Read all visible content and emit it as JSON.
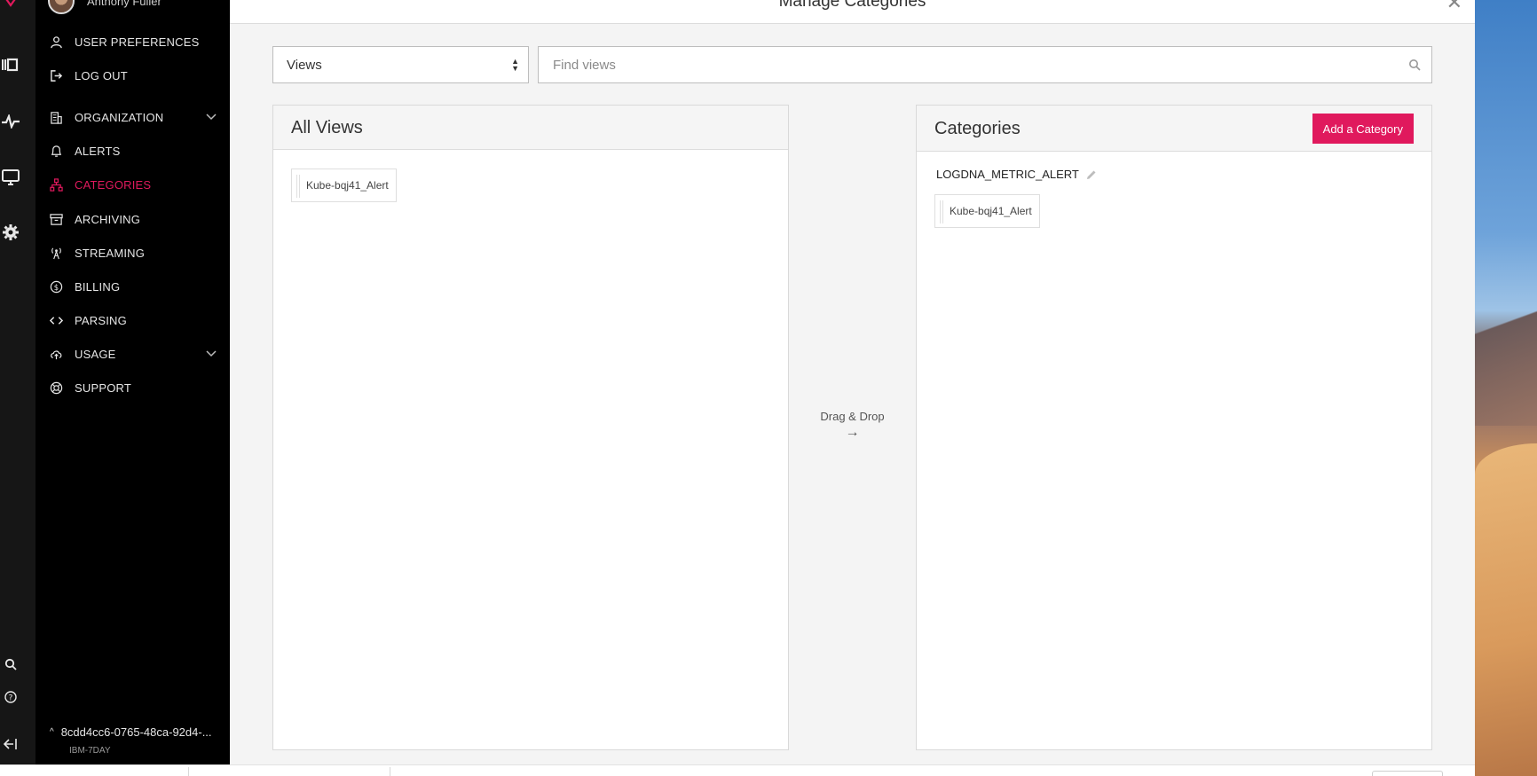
{
  "sidebar": {
    "user_name": "Anthony Fuller",
    "items": [
      {
        "label": "USER PREFERENCES",
        "icon": "user-icon"
      },
      {
        "label": "LOG OUT",
        "icon": "logout-icon"
      },
      {
        "label": "ORGANIZATION",
        "icon": "building-icon",
        "expandable": true
      },
      {
        "label": "ALERTS",
        "icon": "bell-icon"
      },
      {
        "label": "CATEGORIES",
        "icon": "hierarchy-icon",
        "active": true
      },
      {
        "label": "ARCHIVING",
        "icon": "archive-icon"
      },
      {
        "label": "STREAMING",
        "icon": "antenna-icon"
      },
      {
        "label": "BILLING",
        "icon": "dollar-icon"
      },
      {
        "label": "PARSING",
        "icon": "code-icon"
      },
      {
        "label": "USAGE",
        "icon": "cloud-upload-icon",
        "expandable": true
      },
      {
        "label": "SUPPORT",
        "icon": "lifebuoy-icon"
      }
    ],
    "workspace_id": "8cdd4cc6-0765-48ca-92d4-...",
    "workspace_plan": "IBM-7DAY"
  },
  "modal": {
    "title": "Manage Categories",
    "type_select": {
      "value": "Views"
    },
    "search": {
      "placeholder": "Find views",
      "value": ""
    },
    "all_views": {
      "title": "All Views",
      "items": [
        "Kube-bqj41_Alert"
      ]
    },
    "drag_hint": {
      "label": "Drag & Drop",
      "arrow": "→"
    },
    "categories": {
      "title": "Categories",
      "add_button": "Add a Category",
      "groups": [
        {
          "name": "LOGDNA_METRIC_ALERT",
          "views": [
            "Kube-bqj41_Alert"
          ]
        }
      ]
    }
  },
  "colors": {
    "accent": "#e0195d",
    "sidebar_bg": "#000000",
    "panel_header_bg": "#f5f5f5"
  }
}
